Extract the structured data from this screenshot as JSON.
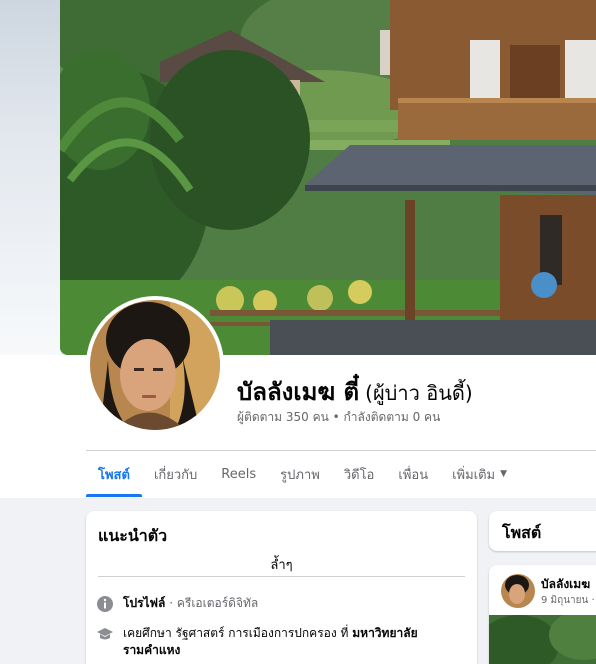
{
  "profile": {
    "name": "บัลลังเมฆ ตี๋",
    "alt_name": "(ผู้บ่าว อินดี้)",
    "followers_line": "ผู้ติดตาม 350 คน • กำลังติดตาม 0 คน"
  },
  "tabs": [
    {
      "label": "โพสต์",
      "active": true
    },
    {
      "label": "เกี่ยวกับ"
    },
    {
      "label": "Reels"
    },
    {
      "label": "รูปภาพ"
    },
    {
      "label": "วิดีโอ"
    },
    {
      "label": "เพื่อน"
    },
    {
      "label": "เพิ่มเติม"
    }
  ],
  "intro": {
    "title": "แนะนำตัว",
    "bio": "ล้ำๆ",
    "profile_label": "โปรไฟล์",
    "profile_type": " · ครีเอเตอร์ดิจิทัล",
    "edu_prefix": "เคยศึกษา รัฐศาสตร์ การเมืองการปกครอง ที่ ",
    "edu_school": "มหาวิทยาลัยรามคำแหง"
  },
  "posts": {
    "title": "โพสต์",
    "author": "บัลลังเมฆ",
    "date": "9 มิถุนายน ·"
  },
  "icons": {
    "info": "info-icon",
    "education": "graduation-cap-icon",
    "dropdown": "caret-down-icon"
  },
  "colors": {
    "accent": "#1877f2",
    "muted_text": "#65676b",
    "page_bg": "#f0f2f5"
  }
}
